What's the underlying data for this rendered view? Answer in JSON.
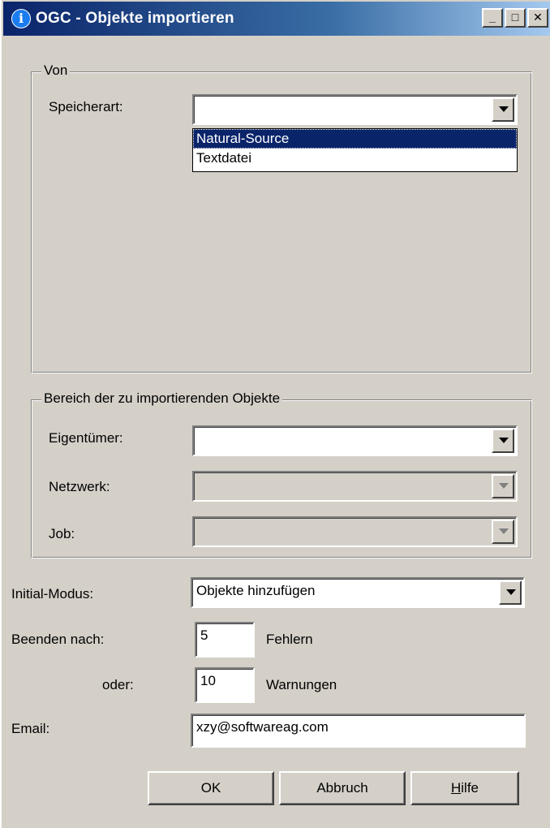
{
  "window": {
    "title": "OGC - Objekte importieren",
    "title_icon": "info-icon",
    "controls": {
      "minimize": "_",
      "maximize": "□",
      "close": "✕"
    }
  },
  "von": {
    "legend": "Von",
    "speicherart_label": "Speicherart:",
    "speicherart_value": "",
    "options": [
      "Natural-Source",
      "Textdatei"
    ],
    "selected_option": "Natural-Source"
  },
  "bereich": {
    "legend": "Bereich der zu importierenden Objekte",
    "eigentuemer_label": "Eigentümer:",
    "eigentuemer_value": "",
    "netzwerk_label": "Netzwerk:",
    "netzwerk_value": "",
    "job_label": "Job:",
    "job_value": ""
  },
  "initial_modus": {
    "label": "Initial-Modus:",
    "value": "Objekte hinzufügen"
  },
  "beenden": {
    "label": "Beenden nach:",
    "fehler_value": "5",
    "fehler_label": "Fehlern",
    "oder_label": "oder:",
    "warnungen_value": "10",
    "warnungen_label": "Warnungen"
  },
  "email": {
    "label": "Email:",
    "value": "xzy@softwareag.com"
  },
  "buttons": {
    "ok": "OK",
    "abbruch": "Abbruch",
    "hilfe_mnemonic": "H",
    "hilfe_rest": "ilfe"
  },
  "colors": {
    "dialog_bg": "#d4d0c8",
    "title_gradient_start": "#0a246a",
    "selection": "#0a246a"
  }
}
